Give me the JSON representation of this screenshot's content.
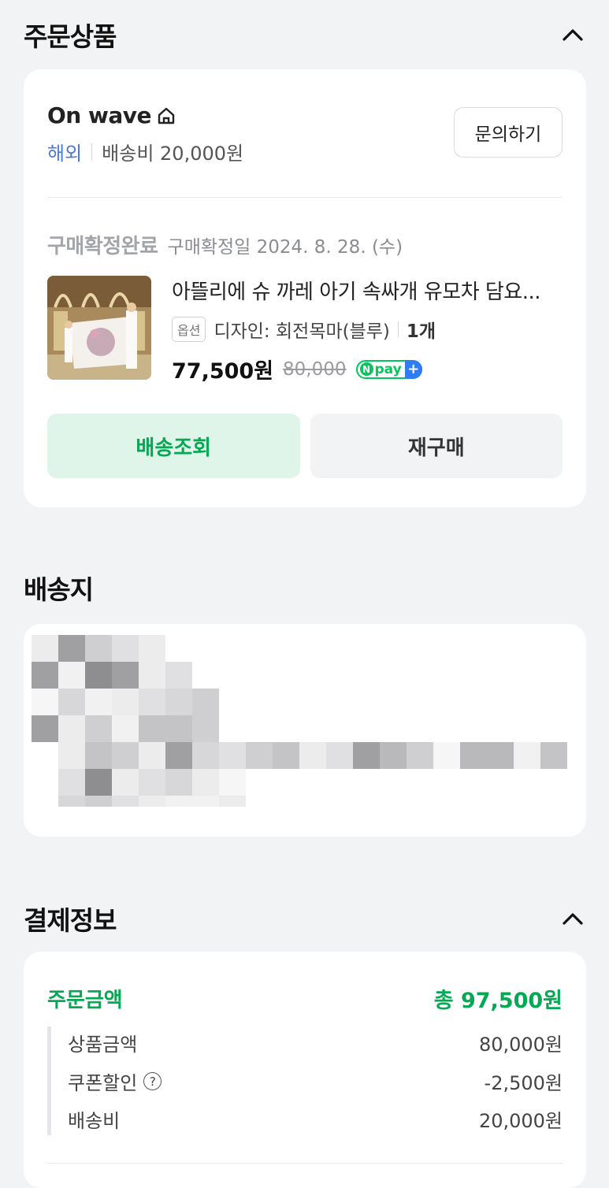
{
  "order_section": {
    "title": "주문상품",
    "collapse_icon": "chevron-up-icon"
  },
  "seller": {
    "name": "On wave",
    "home_icon": "home-icon",
    "region": "해외",
    "shipping": "배송비 20,000원",
    "inquiry_label": "문의하기"
  },
  "order": {
    "status": "구매확정완료",
    "status_date": "구매확정일 2024. 8. 28. (수)",
    "product_name": "아뜰리에 슈 까레 아기 속싸개 유모차 담요...",
    "option_badge": "옵션",
    "option_text": "디자인: 회전목마(블루)",
    "quantity": "1개",
    "price": "77,500원",
    "original_price": "80,000",
    "npay_label": "pay",
    "npay_n": "N",
    "npay_plus": "+",
    "track_label": "배송조회",
    "rebuy_label": "재구매"
  },
  "address_section": {
    "title": "배송지"
  },
  "payment_section": {
    "title": "결제정보",
    "collapse_icon": "chevron-up-icon",
    "total_label": "주문금액",
    "total_value": "총 97,500원",
    "items": [
      {
        "label": "상품금액",
        "value": "80,000원"
      },
      {
        "label": "쿠폰할인",
        "value": "-2,500원",
        "help": "?"
      },
      {
        "label": "배송비",
        "value": "20,000원"
      }
    ]
  },
  "colors": {
    "accent_green": "#05a853",
    "overseas_blue": "#4b7ad6",
    "npay_green": "#03c75a"
  }
}
